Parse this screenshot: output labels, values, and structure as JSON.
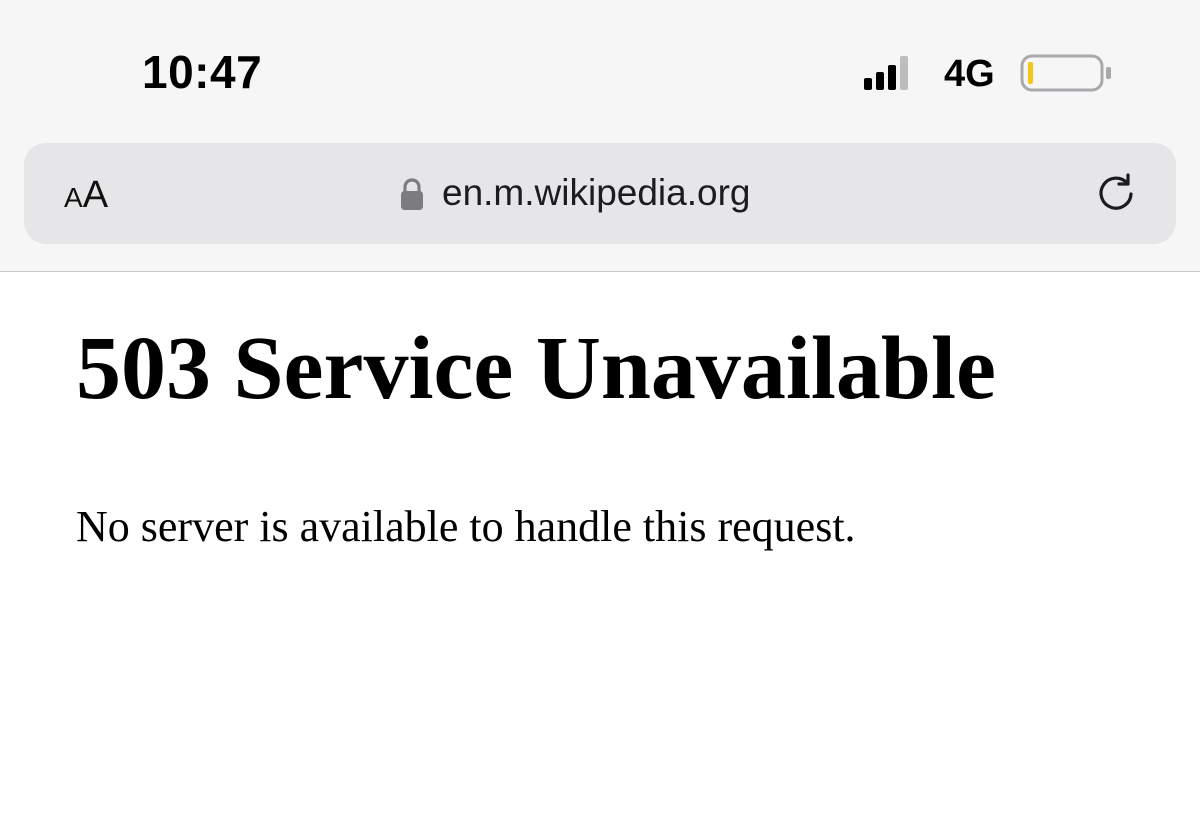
{
  "status_bar": {
    "time": "10:47",
    "network": "4G",
    "signal_bars": 3,
    "signal_bars_max": 4,
    "battery_level": 0.05,
    "battery_color": "#f5c518"
  },
  "browser": {
    "reader_label_small": "A",
    "reader_label_large": "A",
    "secure_icon": "lock-icon",
    "url": "en.m.wikipedia.org",
    "reload_icon": "reload-icon",
    "url_bar_color": "#e6e6e8",
    "chrome_color": "#f6f6f6"
  },
  "page": {
    "title": "503 Service Unavailable",
    "message": "No server is available to handle this request."
  }
}
